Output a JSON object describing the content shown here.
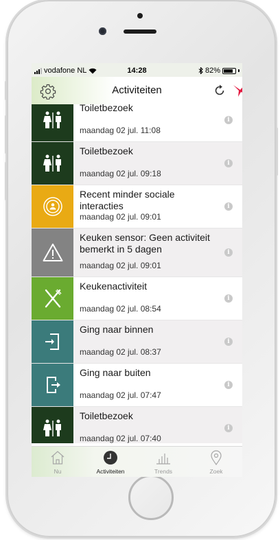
{
  "statusbar": {
    "carrier": "vodafone NL",
    "time": "14:28",
    "battery": "82%",
    "battery_level": 0.82
  },
  "navbar": {
    "title": "Activiteiten",
    "settings_icon": "gear-icon",
    "refresh_icon": "refresh-icon",
    "logo_icon": "bird-logo-icon"
  },
  "activities": [
    {
      "title": "Toiletbezoek",
      "time": "maandag 02 jul. 11:08",
      "icon": "toilet-icon",
      "color": "#1d3b1d"
    },
    {
      "title": "Toiletbezoek",
      "time": "maandag 02 jul. 09:18",
      "icon": "toilet-icon",
      "color": "#1d3b1d"
    },
    {
      "title": "Recent minder sociale interacties",
      "time": "maandag 02 jul. 09:01",
      "icon": "social-icon",
      "color": "#e9aa14"
    },
    {
      "title": "Keuken sensor: Geen activiteit bemerkt in 5 dagen",
      "time": "maandag 02 jul. 09:01",
      "icon": "warning-icon",
      "color": "#838383"
    },
    {
      "title": "Keukenactiviteit",
      "time": "maandag 02 jul. 08:54",
      "icon": "cutlery-icon",
      "color": "#6aab30"
    },
    {
      "title": "Ging naar binnen",
      "time": "maandag 02 jul. 08:37",
      "icon": "enter-icon",
      "color": "#3b7b7b"
    },
    {
      "title": "Ging naar buiten",
      "time": "maandag 02 jul. 07:47",
      "icon": "exit-icon",
      "color": "#3b7b7b"
    },
    {
      "title": "Toiletbezoek",
      "time": "maandag 02 jul. 07:40",
      "icon": "toilet-icon",
      "color": "#1d3b1d"
    }
  ],
  "tabbar": {
    "tabs": [
      {
        "label": "Nu",
        "icon": "home-icon"
      },
      {
        "label": "Activiteiten",
        "icon": "clock-icon"
      },
      {
        "label": "Trends",
        "icon": "bar-chart-icon"
      },
      {
        "label": "Zoek",
        "icon": "location-pin-icon"
      }
    ],
    "active": "Activiteiten"
  }
}
